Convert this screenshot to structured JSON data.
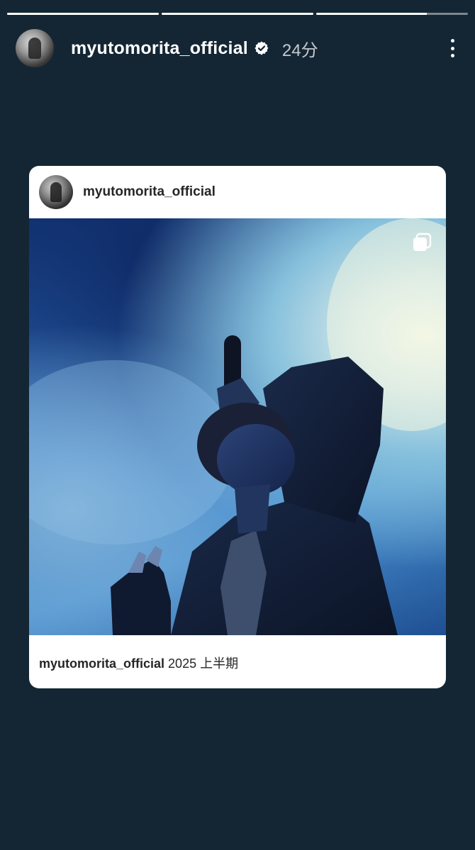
{
  "story": {
    "progress": [
      1.0,
      1.0,
      0.73
    ],
    "header": {
      "username": "myutomorita_official",
      "time": "24分",
      "avatar_icon": "profile-avatar",
      "verified_icon": "verified-badge-icon",
      "more_icon": "more-vertical-icon"
    },
    "card": {
      "username": "myutomorita_official",
      "caption_user": "myutomorita_official",
      "caption_text": "2025 上半期",
      "multi_icon": "carousel-icon"
    }
  },
  "colors": {
    "background": "#142634",
    "card": "#ffffff",
    "text_dark": "#262626",
    "text_light": "#ffffff"
  }
}
